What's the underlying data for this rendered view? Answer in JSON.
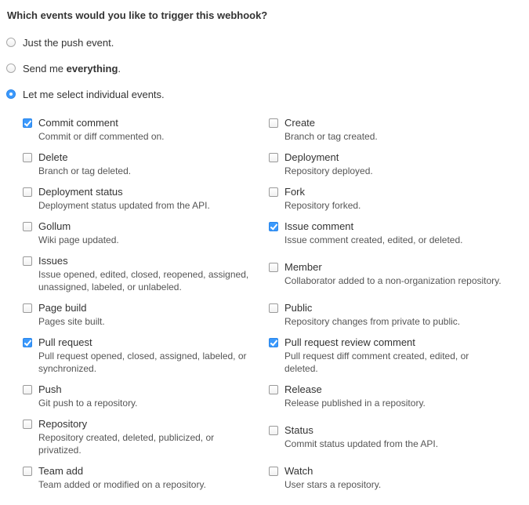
{
  "form": {
    "question": "Which events would you like to trigger this webhook?",
    "options": [
      {
        "pre": "Just the push event.",
        "bold": "",
        "post": "",
        "checked": false
      },
      {
        "pre": "Send me ",
        "bold": "everything",
        "post": ".",
        "checked": false
      },
      {
        "pre": "Let me select individual events.",
        "bold": "",
        "post": "",
        "checked": true
      }
    ]
  },
  "events": [
    {
      "title": "Commit comment",
      "desc": "Commit or diff commented on.",
      "checked": true
    },
    {
      "title": "Create",
      "desc": "Branch or tag created.",
      "checked": false
    },
    {
      "title": "Delete",
      "desc": "Branch or tag deleted.",
      "checked": false
    },
    {
      "title": "Deployment",
      "desc": "Repository deployed.",
      "checked": false
    },
    {
      "title": "Deployment status",
      "desc": "Deployment status updated from the API.",
      "checked": false
    },
    {
      "title": "Fork",
      "desc": "Repository forked.",
      "checked": false
    },
    {
      "title": "Gollum",
      "desc": "Wiki page updated.",
      "checked": false
    },
    {
      "title": "Issue comment",
      "desc": "Issue comment created, edited, or deleted.",
      "checked": true
    },
    {
      "title": "Issues",
      "desc": "Issue opened, edited, closed, reopened, assigned, unassigned, labeled, or unlabeled.",
      "checked": false
    },
    {
      "title": "Member",
      "desc": "Collaborator added to a non-organization repository.",
      "checked": false
    },
    {
      "title": "Page build",
      "desc": "Pages site built.",
      "checked": false
    },
    {
      "title": "Public",
      "desc": "Repository changes from private to public.",
      "checked": false
    },
    {
      "title": "Pull request",
      "desc": "Pull request opened, closed, assigned, labeled, or synchronized.",
      "checked": true
    },
    {
      "title": "Pull request review comment",
      "desc": "Pull request diff comment created, edited, or deleted.",
      "checked": true
    },
    {
      "title": "Push",
      "desc": "Git push to a repository.",
      "checked": false
    },
    {
      "title": "Release",
      "desc": "Release published in a repository.",
      "checked": false
    },
    {
      "title": "Repository",
      "desc": "Repository created, deleted, publicized, or privatized.",
      "checked": false
    },
    {
      "title": "Status",
      "desc": "Commit status updated from the API.",
      "checked": false
    },
    {
      "title": "Team add",
      "desc": "Team added or modified on a repository.",
      "checked": false
    },
    {
      "title": "Watch",
      "desc": "User stars a repository.",
      "checked": false
    }
  ]
}
